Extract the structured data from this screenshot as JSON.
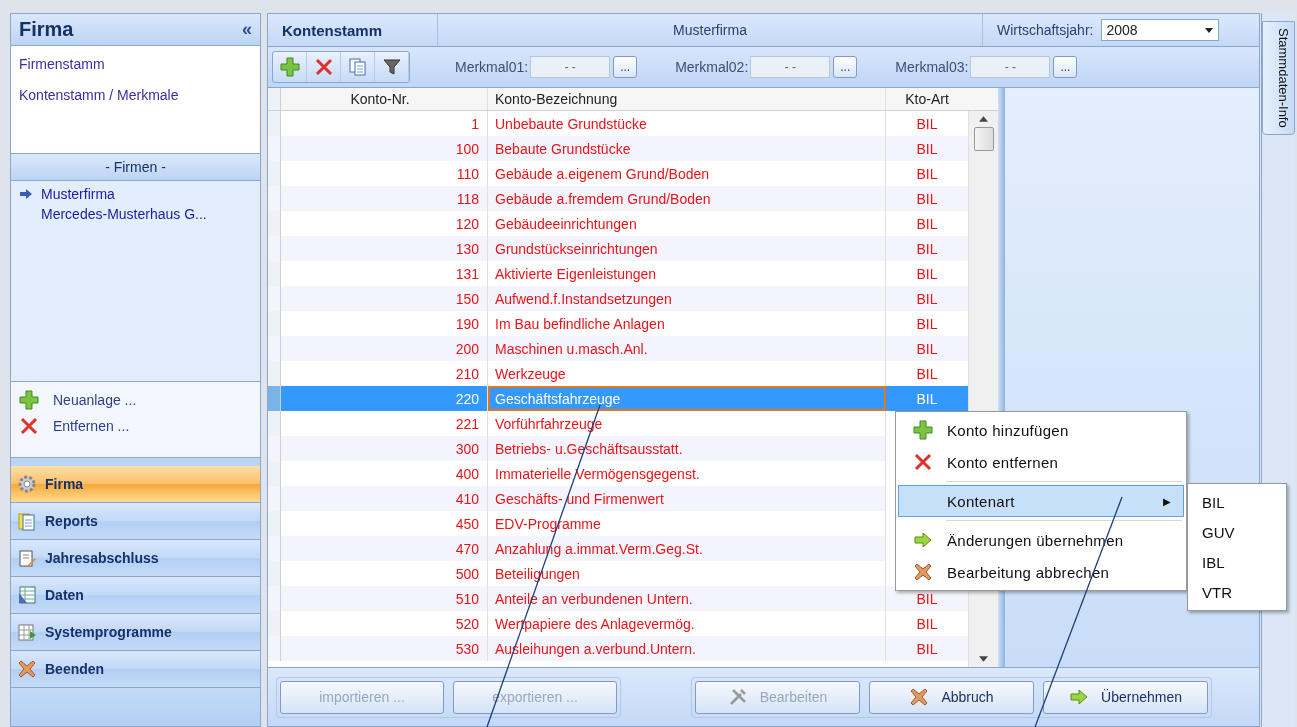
{
  "sidebar": {
    "title": "Firma",
    "collapse_glyph": "«",
    "links": [
      "Firmenstamm",
      "Kontenstamm / Merkmale"
    ],
    "companies_header": "- Firmen -",
    "companies": [
      {
        "name": "Musterfirma",
        "selected": true
      },
      {
        "name": "Mercedes-Musterhaus G...",
        "selected": false
      }
    ],
    "actions": [
      {
        "label": "Neuanlage ...",
        "kind": "add"
      },
      {
        "label": "Entfernen ...",
        "kind": "remove"
      }
    ],
    "nav": [
      {
        "label": "Firma",
        "kind": "gear",
        "selected": true
      },
      {
        "label": "Reports",
        "kind": "clipboard",
        "selected": false
      },
      {
        "label": "Jahresabschluss",
        "kind": "edit",
        "selected": false
      },
      {
        "label": "Daten",
        "kind": "table",
        "selected": false
      },
      {
        "label": "Systemprogramme",
        "kind": "grid",
        "selected": false
      },
      {
        "label": "Beenden",
        "kind": "exit",
        "selected": false
      }
    ]
  },
  "header": {
    "title": "Kontenstamm",
    "company": "Musterfirma",
    "year_label": "Wirtschaftsjahr:",
    "year": "2008"
  },
  "toolbar": {
    "tools": [
      {
        "kind": "add"
      },
      {
        "kind": "remove"
      },
      {
        "kind": "copy"
      },
      {
        "kind": "filter"
      }
    ],
    "features": [
      {
        "label": "Merkmal01:",
        "value": "- -",
        "button": "..."
      },
      {
        "label": "Merkmal02:",
        "value": "- -",
        "button": "..."
      },
      {
        "label": "Merkmal03:",
        "value": "- -",
        "button": "..."
      }
    ]
  },
  "table": {
    "columns": [
      "Konto-Nr.",
      "Konto-Bezeichnung",
      "Kto-Art"
    ],
    "rows": [
      {
        "nr": "1",
        "name": "Unbebaute Grundstücke",
        "type": "BIL",
        "selected": false
      },
      {
        "nr": "100",
        "name": "Bebaute Grundstücke",
        "type": "BIL",
        "selected": false
      },
      {
        "nr": "110",
        "name": "Gebäude a.eigenem Grund/Boden",
        "type": "BIL",
        "selected": false
      },
      {
        "nr": "118",
        "name": "Gebäude a.fremdem Grund/Boden",
        "type": "BIL",
        "selected": false
      },
      {
        "nr": "120",
        "name": "Gebäudeeinrichtungen",
        "type": "BIL",
        "selected": false
      },
      {
        "nr": "130",
        "name": "Grundstückseinrichtungen",
        "type": "BIL",
        "selected": false
      },
      {
        "nr": "131",
        "name": "Aktivierte Eigenleistungen",
        "type": "BIL",
        "selected": false
      },
      {
        "nr": "150",
        "name": "Aufwend.f.Instandsetzungen",
        "type": "BIL",
        "selected": false
      },
      {
        "nr": "190",
        "name": "Im Bau befindliche Anlagen",
        "type": "BIL",
        "selected": false
      },
      {
        "nr": "200",
        "name": "Maschinen u.masch.Anl.",
        "type": "BIL",
        "selected": false
      },
      {
        "nr": "210",
        "name": "Werkzeuge",
        "type": "BIL",
        "selected": false
      },
      {
        "nr": "220",
        "name": "Geschäftsfahrzeuge",
        "type": "BIL",
        "selected": true
      },
      {
        "nr": "221",
        "name": "Vorführfahrzeuge",
        "selected": false
      },
      {
        "nr": "300",
        "name": "Betriebs- u.Geschäftsausstatt.",
        "selected": false
      },
      {
        "nr": "400",
        "name": "Immaterielle Vermögensgegenst.",
        "selected": false
      },
      {
        "nr": "410",
        "name": "Geschäfts- und Firmenwert",
        "selected": false
      },
      {
        "nr": "450",
        "name": "EDV-Programme",
        "selected": false
      },
      {
        "nr": "470",
        "name": "Anzahlung a.immat.Verm.Geg.St.",
        "selected": false
      },
      {
        "nr": "500",
        "name": "Beteiligungen",
        "selected": false
      },
      {
        "nr": "510",
        "name": "Anteile an verbundenen Untern.",
        "type": "BIL",
        "selected": false
      },
      {
        "nr": "520",
        "name": "Wertpapiere des Anlagevermög.",
        "type": "BIL",
        "selected": false
      },
      {
        "nr": "530",
        "name": "Ausleihungen a.verbund.Untern.",
        "type": "BIL",
        "selected": false
      }
    ]
  },
  "context_menu": {
    "items": [
      {
        "kind": "add",
        "label": "Konto hinzufügen",
        "selected": false
      },
      {
        "kind": "remove",
        "label": "Konto entfernen",
        "selected": false
      },
      {
        "kind": "separator"
      },
      {
        "kind": "submenu",
        "label": "Kontenart",
        "arrow": "▶",
        "selected": true
      },
      {
        "kind": "separator"
      },
      {
        "kind": "apply",
        "label": "Änderungen übernehmen",
        "selected": false
      },
      {
        "kind": "cancel",
        "label": "Bearbeitung abbrechen",
        "selected": false
      }
    ],
    "submenu": [
      "BIL",
      "GUV",
      "IBL",
      "VTR"
    ]
  },
  "buttons": [
    {
      "label": "importieren ...",
      "kind": "import",
      "disabled": true
    },
    {
      "label": "exportieren ...",
      "kind": "export",
      "disabled": true
    },
    {
      "label": "Bearbeiten",
      "kind": "tools",
      "disabled": true
    },
    {
      "label": "Abbruch",
      "kind": "cancel",
      "disabled": false
    },
    {
      "label": "Übernehmen",
      "kind": "apply",
      "disabled": false
    }
  ],
  "side_tab": {
    "label": "Stammdaten-Info"
  }
}
